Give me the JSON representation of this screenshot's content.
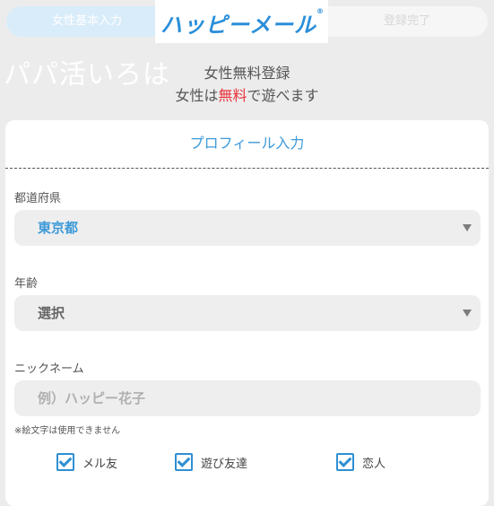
{
  "header": {
    "step_current": "女性基本入力",
    "step_final": "登録完了",
    "logo_text": "ハッピーメール",
    "logo_mark": "®"
  },
  "background_word": "パパ活いろは",
  "title": {
    "line1": "女性無料登録",
    "line2_pre": "女性は",
    "line2_em": "無料",
    "line2_post": "で遊べます"
  },
  "form": {
    "heading": "プロフィール入力",
    "prefecture": {
      "label": "都道府県",
      "value": "東京都"
    },
    "age": {
      "label": "年齢",
      "value": "選択"
    },
    "nickname": {
      "label": "ニックネーム",
      "value": "",
      "placeholder": "例）ハッピー花子",
      "note": "※絵文字は使用できません"
    },
    "purposes": [
      {
        "label": "メル友",
        "checked": true
      },
      {
        "label": "遊び友達",
        "checked": true
      },
      {
        "label": "恋人",
        "checked": true
      }
    ]
  },
  "colors": {
    "accent": "#3d9ad8",
    "emphasis": "#e8333a",
    "background": "#ececec"
  }
}
